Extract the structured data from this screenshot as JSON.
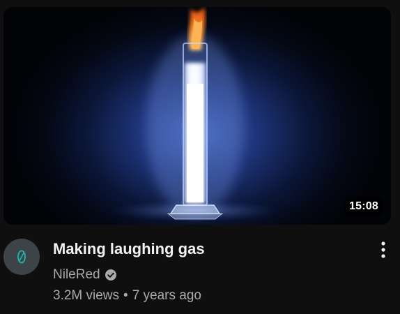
{
  "video": {
    "duration": "15:08",
    "title": "Making laughing gas",
    "channel": "NileRed",
    "views": "3.2M views",
    "separator": "•",
    "age": "7 years ago"
  },
  "icons": {
    "verified": "verified-check-icon",
    "menu": "more-vert-icon",
    "avatar": "nilered-logo-icon"
  },
  "colors": {
    "background": "#0f0f0f",
    "title": "#f1f1f1",
    "secondary_text": "#aaaaaa",
    "avatar_bg": "#3d4347",
    "avatar_logo": "#1fb5a8"
  }
}
